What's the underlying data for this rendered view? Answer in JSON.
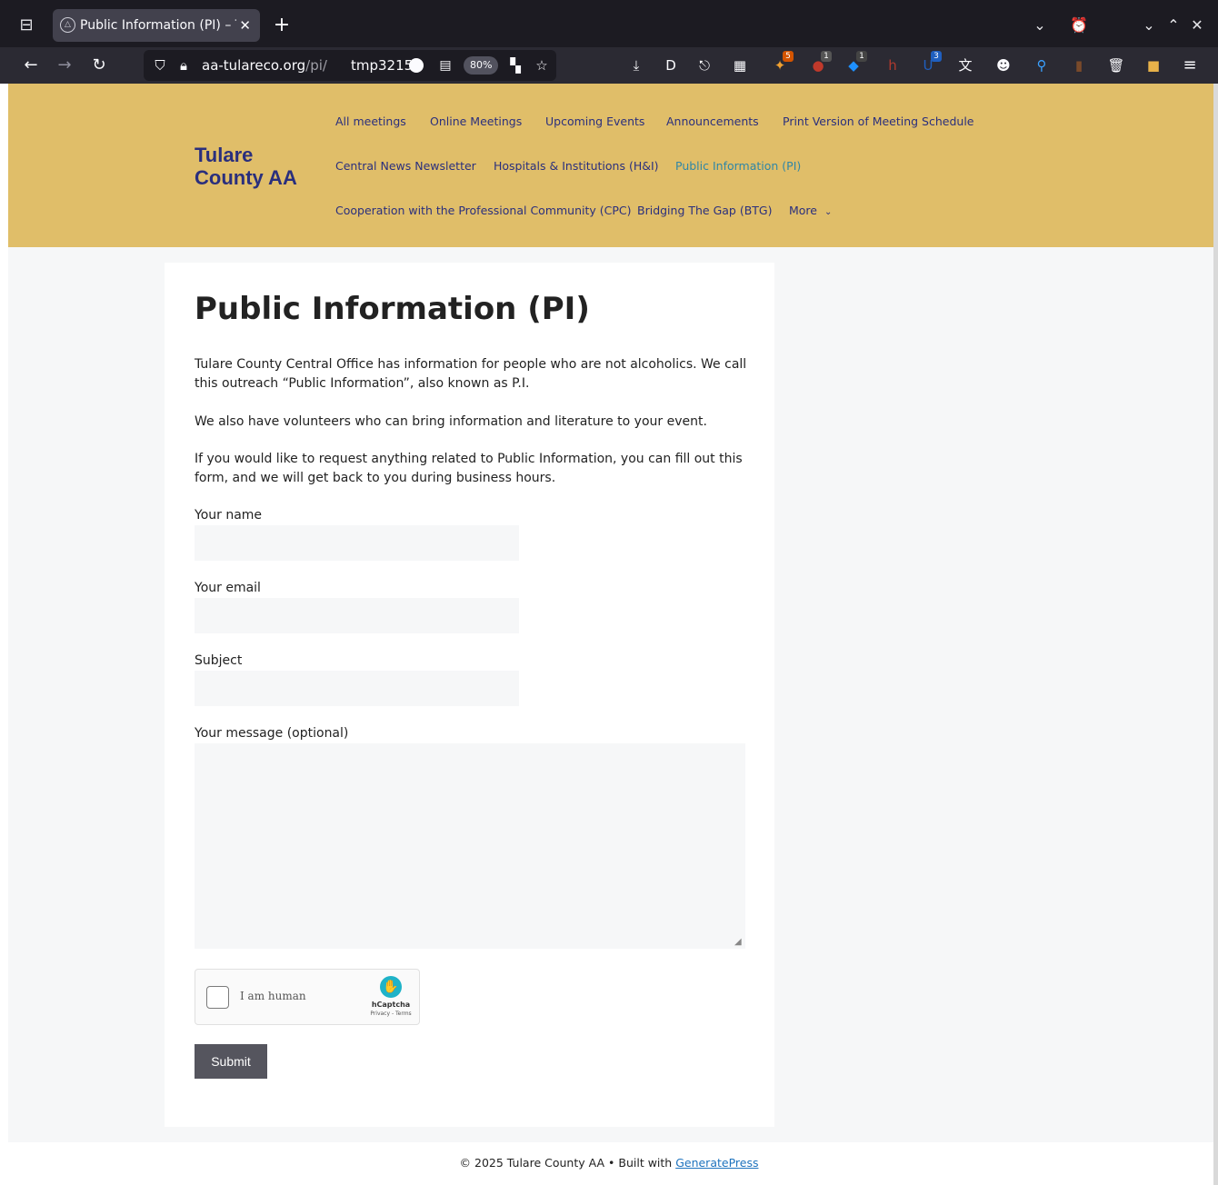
{
  "browser": {
    "tab": {
      "title": "Public Information (PI) – Tulare County AA"
    },
    "url": {
      "host": "aa-tulareco.org",
      "path": "/pi/",
      "extra": "tmp3215"
    },
    "zoom": "80%",
    "extensions": [
      {
        "icon": "download-icon",
        "glyph": "⤓"
      },
      {
        "icon": "duckduckgo-icon",
        "glyph": "D"
      },
      {
        "icon": "share-icon",
        "glyph": "⎋"
      },
      {
        "icon": "grid-extension-icon",
        "glyph": "▦"
      },
      {
        "icon": "wand-extension-icon",
        "glyph": "✦",
        "badge": "5"
      },
      {
        "icon": "ublock-icon",
        "glyph": "●",
        "badge": "1"
      },
      {
        "icon": "container-extension-icon",
        "glyph": "◆",
        "badge": "1"
      },
      {
        "icon": "hypothesis-icon",
        "glyph": "h"
      },
      {
        "icon": "bitwarden-icon",
        "glyph": "U",
        "badge": "3"
      },
      {
        "icon": "translate-icon",
        "glyph": "文"
      },
      {
        "icon": "reddit-icon",
        "glyph": "☻"
      },
      {
        "icon": "search-extension-icon",
        "glyph": "⚲"
      },
      {
        "icon": "notes-extension-icon",
        "glyph": "▮"
      },
      {
        "icon": "trash-extension-icon",
        "glyph": "🗑"
      },
      {
        "icon": "box-extension-icon",
        "glyph": "■"
      }
    ]
  },
  "site": {
    "title": "Tulare County AA",
    "menu": [
      "All meetings",
      "Online Meetings",
      "Upcoming Events",
      "Announcements",
      "Print Version of Meeting Schedule",
      "Central News Newsletter",
      "Hospitals & Institutions (H&I)",
      "Public Information (PI)",
      "Cooperation with the Professional Community (CPC)",
      "Bridging The Gap (BTG)",
      "More"
    ]
  },
  "page": {
    "title": "Public Information (PI)",
    "paragraphs": [
      "Tulare County Central Office has information for people who are not alcoholics. We call this outreach “Public Information”, also known as P.I.",
      "We also have volunteers who can bring information and literature to your event.",
      "If you would like to request anything related to Public Information, you can fill out this form, and we will get back to you during business hours."
    ],
    "form": {
      "name_label": "Your name",
      "email_label": "Your email",
      "subject_label": "Subject",
      "message_label": "Your message (optional)",
      "captcha_label": "I am human",
      "captcha_brand": "hCaptcha",
      "captcha_terms": "Privacy - Terms",
      "submit_label": "Submit"
    }
  },
  "footer": {
    "text": "© 2025 Tulare County AA • Built with ",
    "link": "GeneratePress"
  }
}
